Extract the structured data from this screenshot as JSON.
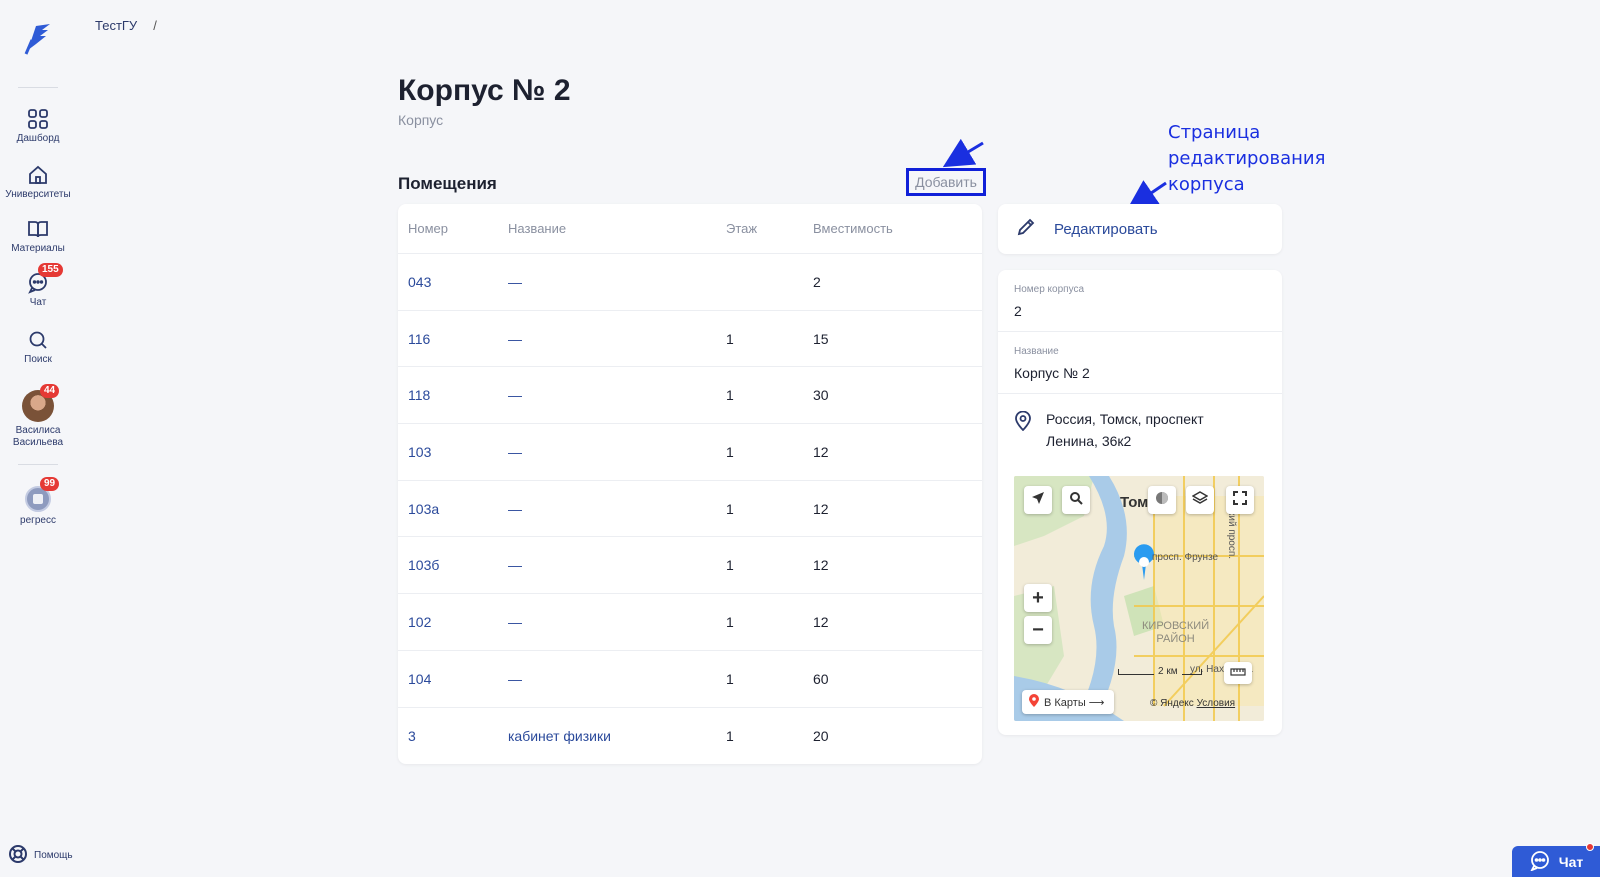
{
  "sidebar": {
    "items": [
      {
        "label": "Дашборд"
      },
      {
        "label": "Университеты"
      },
      {
        "label": "Материалы"
      },
      {
        "label": "Чат",
        "badge": "155"
      },
      {
        "label": "Поиск"
      },
      {
        "label": "Василиса Васильева",
        "badge": "44"
      },
      {
        "label": "регресс",
        "badge": "99"
      }
    ],
    "help_label": "Помощь"
  },
  "breadcrumb": {
    "root": "ТестГУ",
    "sep": "/"
  },
  "page": {
    "title": "Корпус № 2",
    "subtitle": "Корпус"
  },
  "rooms": {
    "section_title": "Помещения",
    "add_label": "Добавить",
    "columns": [
      "Номер",
      "Название",
      "Этаж",
      "Вместимость"
    ],
    "rows": [
      {
        "number": "043",
        "name": "—",
        "floor": "",
        "capacity": "2"
      },
      {
        "number": "116",
        "name": "—",
        "floor": "1",
        "capacity": "15"
      },
      {
        "number": "118",
        "name": "—",
        "floor": "1",
        "capacity": "30"
      },
      {
        "number": "103",
        "name": "—",
        "floor": "1",
        "capacity": "12"
      },
      {
        "number": "103а",
        "name": "—",
        "floor": "1",
        "capacity": "12"
      },
      {
        "number": "103б",
        "name": "—",
        "floor": "1",
        "capacity": "12"
      },
      {
        "number": "102",
        "name": "—",
        "floor": "1",
        "capacity": "12"
      },
      {
        "number": "104",
        "name": "—",
        "floor": "1",
        "capacity": "60"
      },
      {
        "number": "3",
        "name": "кабинет физики",
        "floor": "1",
        "capacity": "20"
      }
    ]
  },
  "edit": {
    "label": "Редактировать"
  },
  "building": {
    "number_label": "Номер корпуса",
    "number_value": "2",
    "name_label": "Название",
    "name_value": "Корпус № 2",
    "address_line1": "Россия, Томск, проспект",
    "address_line2": "Ленина, 36к2"
  },
  "map": {
    "city": "Том",
    "street": "просп. Фрунзе",
    "vert_street": "ский просп.",
    "district_line1": "КИРОВСКИЙ",
    "district_line2": "РАЙОН",
    "scale": "2 км",
    "street2": "ул. Нахимова",
    "karty_label": "В Карты ⟶",
    "copyright": "© Яндекс",
    "terms": "Условия"
  },
  "annotation": {
    "line1": "Страница",
    "line2": "редактирования",
    "line3": "корпуса"
  },
  "chat_fab": {
    "label": "Чат"
  },
  "colors": {
    "accent": "#2b4a9b",
    "highlight_box": "#1020d8",
    "annotation": "#1a2fe0",
    "badge": "#e53935"
  }
}
